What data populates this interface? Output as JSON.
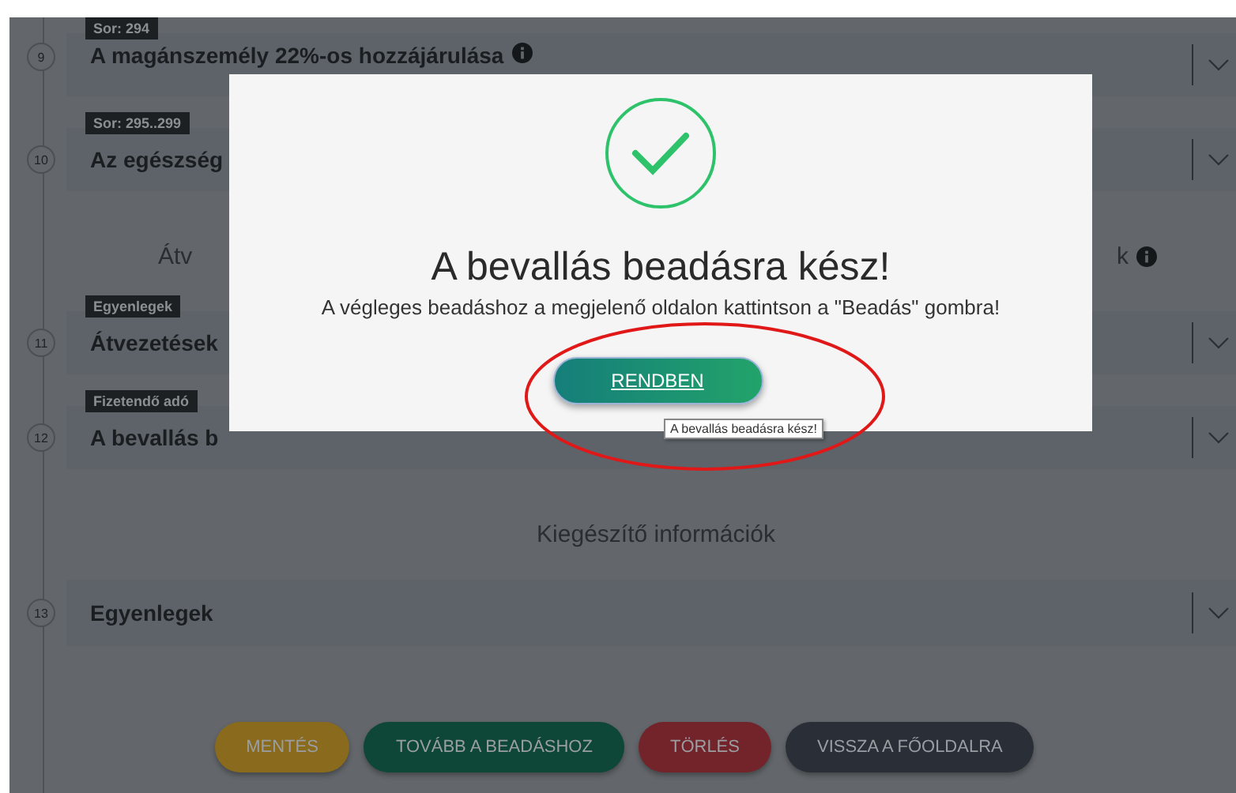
{
  "sections": [
    {
      "kind": "row",
      "number": "9",
      "tag": "Sor: 294",
      "title": "A magánszemély 22%-os hozzájárulása",
      "info": true
    },
    {
      "kind": "row",
      "number": "10",
      "tag": "Sor: 295..299",
      "title": "Az egészség",
      "info": false
    },
    {
      "kind": "heading",
      "text": "Átv",
      "text_end": "k",
      "info": true
    },
    {
      "kind": "row",
      "number": "11",
      "tag": "Egyenlegek",
      "title": "Átvezetések",
      "info": false
    },
    {
      "kind": "row",
      "number": "12",
      "tag": "Fizetendő adó",
      "title": "A bevallás b",
      "info": false
    },
    {
      "kind": "heading",
      "text": "Kiegészítő információk",
      "info": false
    },
    {
      "kind": "row",
      "number": "13",
      "title": "Egyenlegek",
      "info": false
    }
  ],
  "buttons": [
    {
      "label": "MENTÉS",
      "color": "#8a6a1c"
    },
    {
      "label": "TOVÁBB A BEADÁSHOZ",
      "color": "#0e4638"
    },
    {
      "label": "TÖRLÉS",
      "color": "#72242a"
    },
    {
      "label": "VISSZA A FŐOLDALRA",
      "color": "#2a2e37"
    }
  ],
  "modal": {
    "title": "A bevallás beadásra kész!",
    "message": "A végleges beadáshoz a megjelenő oldalon kattintson a \"Beadás\" gombra!",
    "button": "RENDBEN",
    "tooltip": "A bevallás beadásra kész!"
  }
}
